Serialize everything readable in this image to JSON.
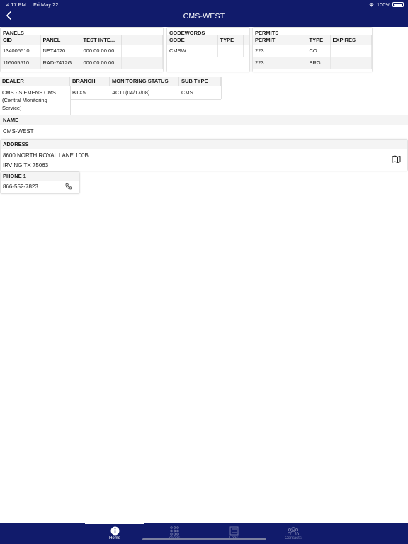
{
  "status": {
    "time": "4:17 PM",
    "date": "Fri May 22",
    "battery": "100%"
  },
  "header": {
    "title": "CMS-WEST"
  },
  "panels": {
    "title": "PANELS",
    "columns": [
      "CID",
      "PANEL",
      "TEST INTE...",
      ""
    ],
    "rows": [
      [
        "134005510",
        "NET4020",
        "000:00:00:00",
        ""
      ],
      [
        "116005510",
        "RAD-7412G",
        "000:00:00:00",
        ""
      ]
    ]
  },
  "codewords": {
    "title": "CODEWORDS",
    "columns": [
      "CODE",
      "TYPE",
      ""
    ],
    "rows": [
      [
        "CMSW",
        "",
        ""
      ]
    ]
  },
  "permits": {
    "title": "PERMITS",
    "columns": [
      "PERMIT",
      "TYPE",
      "EXPIRES",
      ""
    ],
    "rows": [
      [
        "223",
        "CO",
        "",
        ""
      ],
      [
        "223",
        "BRG",
        "",
        ""
      ]
    ]
  },
  "info": {
    "dealer": {
      "label": "DEALER",
      "value": "CMS - SIEMENS CMS (Central Monitoring Service)"
    },
    "branch": {
      "label": "BRANCH",
      "value": "BTX5"
    },
    "monitoring_status": {
      "label": "MONITORING STATUS",
      "value": "ACTI (04/17/08)"
    },
    "sub_type": {
      "label": "SUB TYPE",
      "value": "CMS"
    }
  },
  "name": {
    "label": "NAME",
    "value": "CMS-WEST"
  },
  "address": {
    "label": "ADDRESS",
    "line1": "8600 NORTH ROYAL LANE 100B",
    "line2": "IRVING TX 75063"
  },
  "phone": {
    "label": "PHONE 1",
    "value": "866-552-7823"
  },
  "tabs": [
    {
      "label": "Home",
      "icon": "info-icon",
      "active": true
    },
    {
      "label": "Zones",
      "icon": "grid-icon",
      "active": false
    },
    {
      "label": "Logs",
      "icon": "log-icon",
      "active": false
    },
    {
      "label": "Contacts",
      "icon": "contacts-icon",
      "active": false
    }
  ]
}
